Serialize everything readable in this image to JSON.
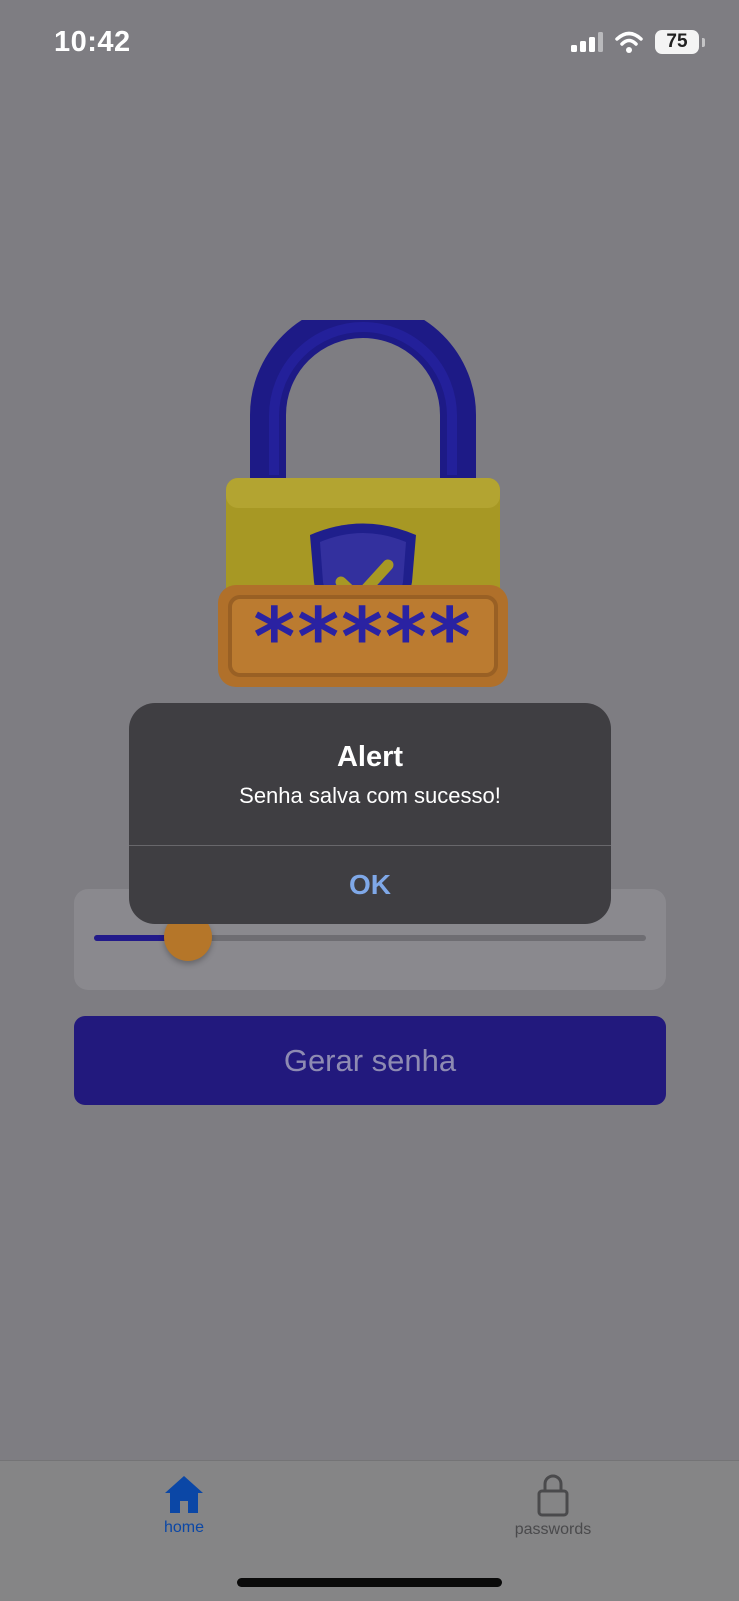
{
  "status_bar": {
    "time": "10:42",
    "battery": "75",
    "icons": [
      "signal-icon",
      "wifi-icon",
      "battery-icon"
    ]
  },
  "illustration": {
    "icon": "padlock-password-icon",
    "masked_text": "*****"
  },
  "slider": {
    "value_fraction": 0.17,
    "colors": {
      "fill": "#221a8a",
      "thumb": "#b57629"
    }
  },
  "generate_button": {
    "label": "Gerar senha",
    "color": "#22197d"
  },
  "alert": {
    "title": "Alert",
    "message": "Senha salva com sucesso!",
    "ok_label": "OK"
  },
  "tab_bar": {
    "tabs": [
      {
        "label": "home",
        "icon": "home-icon",
        "active": true
      },
      {
        "label": "passwords",
        "icon": "lock-icon",
        "active": false
      }
    ],
    "active_color": "#0b47a6"
  }
}
